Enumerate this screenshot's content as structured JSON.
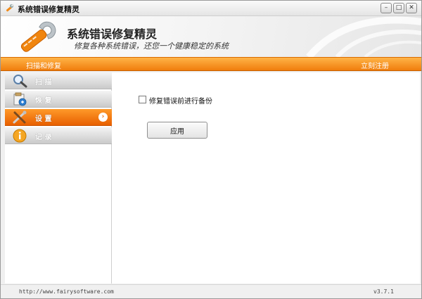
{
  "window": {
    "title": "系统错误修复精灵",
    "controls": {
      "minimize": "–",
      "maximize": "□",
      "close": "✕"
    }
  },
  "banner": {
    "title": "系统错误修复精灵",
    "subtitle": "修复各种系统错误，还您一个健康稳定的系统",
    "logo_icon": "wrench-icon"
  },
  "menubar": {
    "left_label": "扫描和修复",
    "right_label": "立刻注册"
  },
  "sidebar": {
    "items": [
      {
        "label": "扫 描",
        "icon": "magnifier-icon",
        "active": false
      },
      {
        "label": "恢 复",
        "icon": "restore-icon",
        "active": false
      },
      {
        "label": "设 置",
        "icon": "tools-icon",
        "active": true
      },
      {
        "label": "记 录",
        "icon": "info-icon",
        "active": false
      }
    ],
    "active_arrow": "›"
  },
  "main": {
    "backup_checkbox_label": "修复错误前进行备份",
    "backup_checked": false,
    "apply_label": "应用"
  },
  "statusbar": {
    "url": "http://www.fairysoftware.com",
    "version": "v3.7.1"
  },
  "colors": {
    "accent": "#f07d0c",
    "accent_light": "#ffb347"
  }
}
